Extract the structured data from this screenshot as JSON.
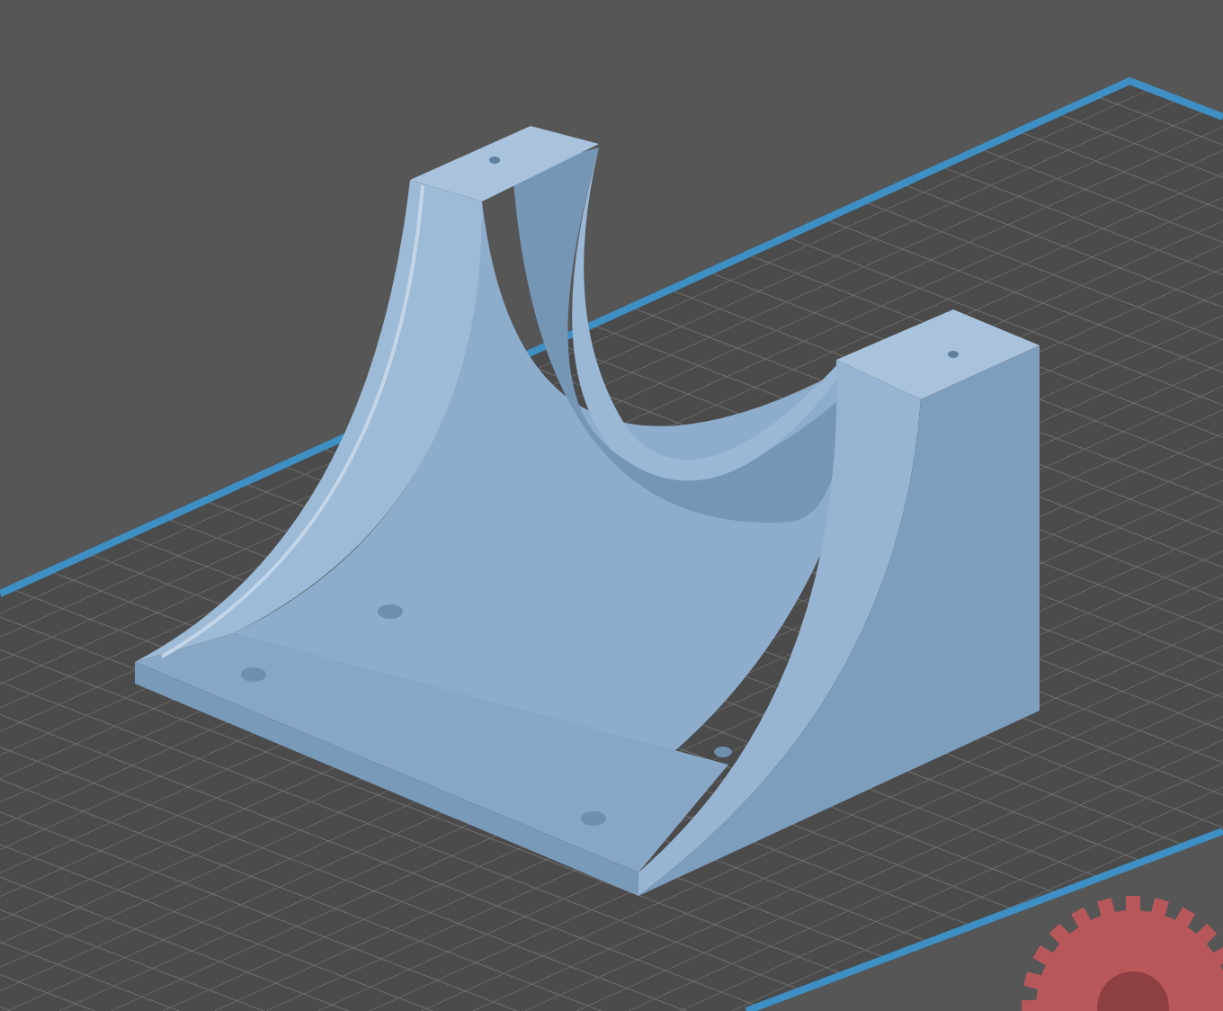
{
  "viewport": {
    "kind": "build-plate"
  }
}
